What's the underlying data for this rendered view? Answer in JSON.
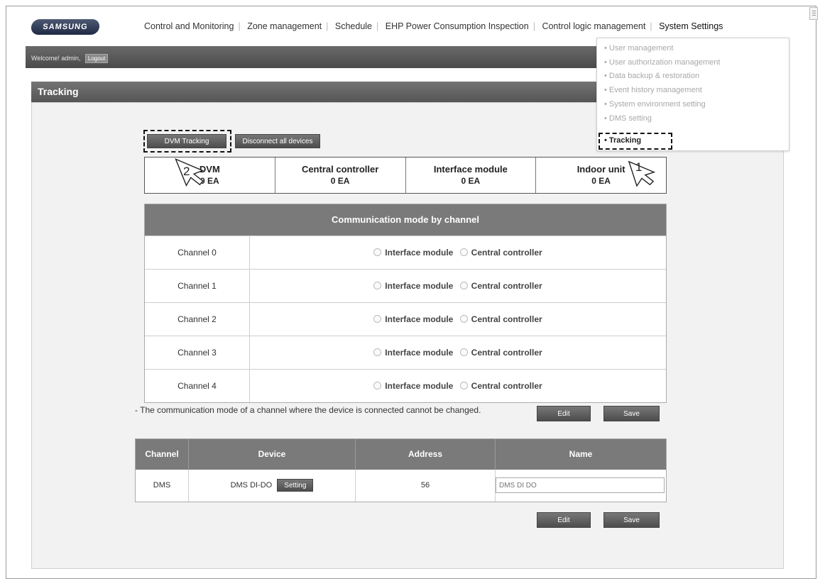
{
  "brand": {
    "logo_text": "SAMSUNG"
  },
  "topnav": {
    "items": [
      "Control and Monitoring",
      "Zone management",
      "Schedule",
      "EHP Power Consumption Inspection",
      "Control logic management",
      "System Settings"
    ],
    "active": "System Settings"
  },
  "header": {
    "welcome": "Welcome! admin,",
    "logout_label": "Logout"
  },
  "section": {
    "title": "Tracking"
  },
  "settings_menu": {
    "items": [
      "• User management",
      "• User authorization management",
      "• Data backup & restoration",
      "• Event history management",
      "• System environment setting",
      "• DMS setting",
      "• Tracking"
    ],
    "selected": "• Tracking"
  },
  "actions": {
    "dvm_tracking_label": "DVM Tracking",
    "disconnect_label": "Disconnect all devices"
  },
  "counts": [
    {
      "label": "DVM",
      "value": "0 EA"
    },
    {
      "label": "Central controller",
      "value": "0 EA"
    },
    {
      "label": "Interface module",
      "value": "0 EA"
    },
    {
      "label": "Indoor unit",
      "value": "0 EA"
    }
  ],
  "channels": {
    "title": "Communication mode by channel",
    "option_a": "Interface module",
    "option_b": "Central controller",
    "rows": [
      {
        "name": "Channel 0"
      },
      {
        "name": "Channel 1"
      },
      {
        "name": "Channel 2"
      },
      {
        "name": "Channel 3"
      },
      {
        "name": "Channel 4"
      }
    ]
  },
  "note": "- The communication mode of a channel where the device is connected cannot be changed.",
  "buttons": {
    "edit_label": "Edit",
    "save_label": "Save"
  },
  "devices": {
    "headers": {
      "channel": "Channel",
      "device": "Device",
      "address": "Address",
      "name": "Name"
    },
    "rows": [
      {
        "channel": "DMS",
        "device": "DMS DI-DO",
        "setting_label": "Setting",
        "address": "56",
        "name_placeholder": "DMS DI DO"
      }
    ]
  },
  "callouts": {
    "one": "1",
    "two": "2"
  }
}
